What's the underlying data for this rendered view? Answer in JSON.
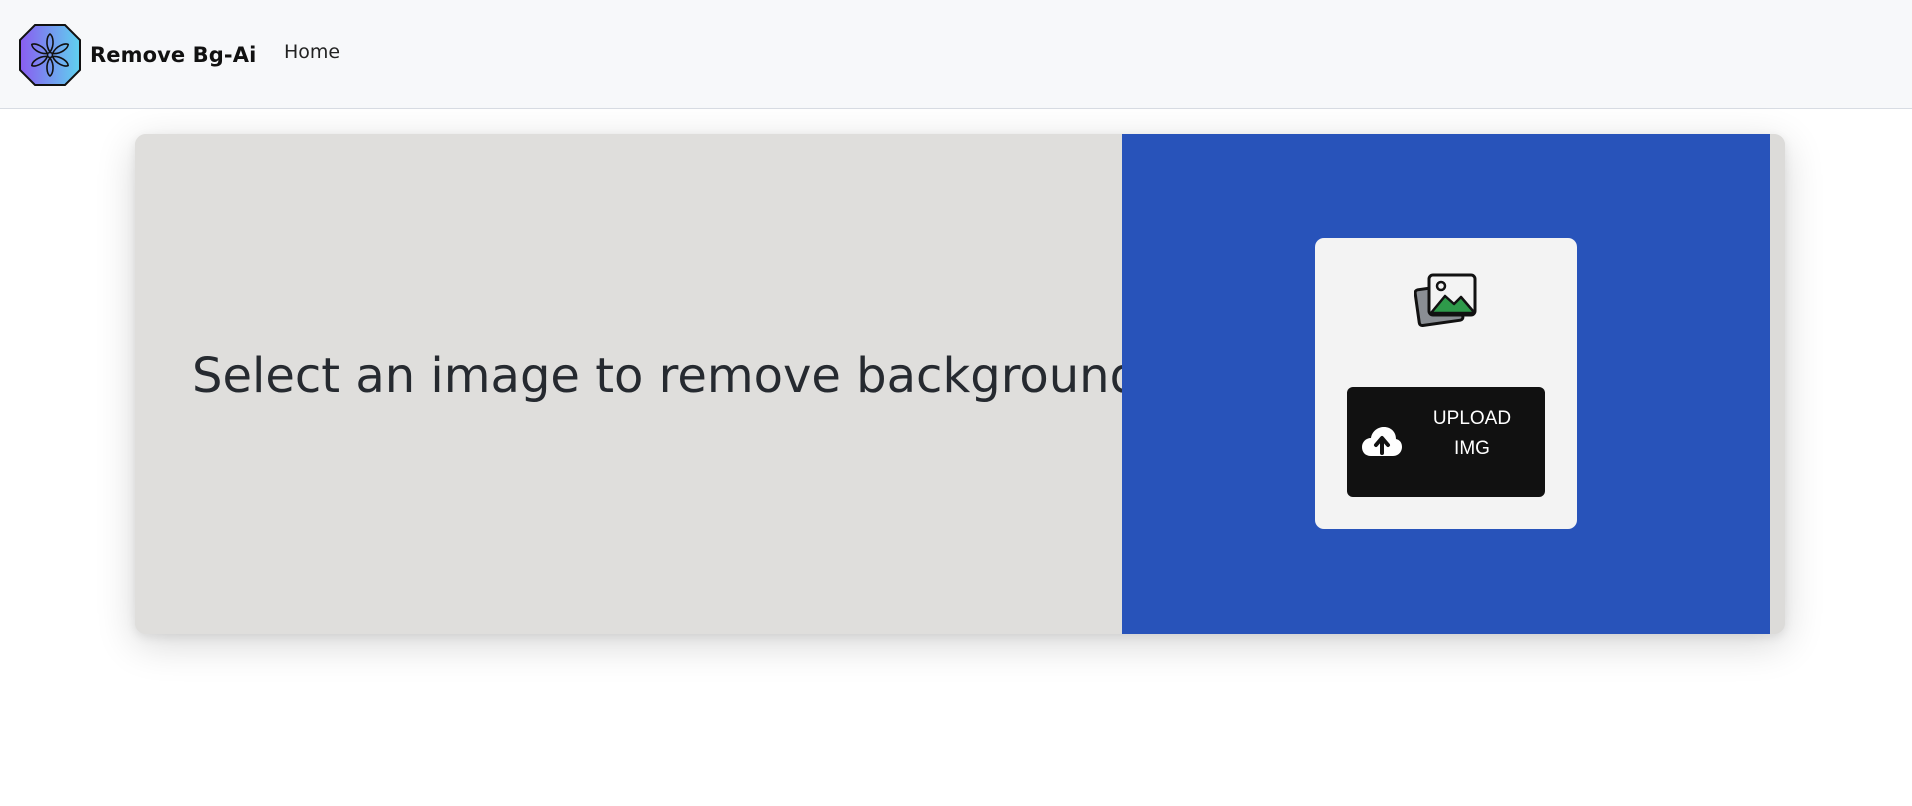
{
  "header": {
    "brand": "Remove Bg-Ai",
    "nav_home": "Home",
    "logo_icon": "flower-logo-icon"
  },
  "hero": {
    "headline": "Select an image to remove background"
  },
  "upload": {
    "image_icon": "image-gallery-icon",
    "button_icon": "cloud-upload-icon",
    "button_label": "UPLOAD\nIMG"
  },
  "colors": {
    "navbar_bg": "#f7f8fa",
    "left_pane_bg": "#dfdedc",
    "right_pane_bg": "#2853ba",
    "upload_box_bg": "#f3f3f3",
    "button_bg": "#111111",
    "headline_text": "#262a30",
    "logo_gradient_start": "#8a5cf0",
    "logo_gradient_end": "#5fd2ef",
    "image_icon_mountain": "#2e9a4a"
  }
}
